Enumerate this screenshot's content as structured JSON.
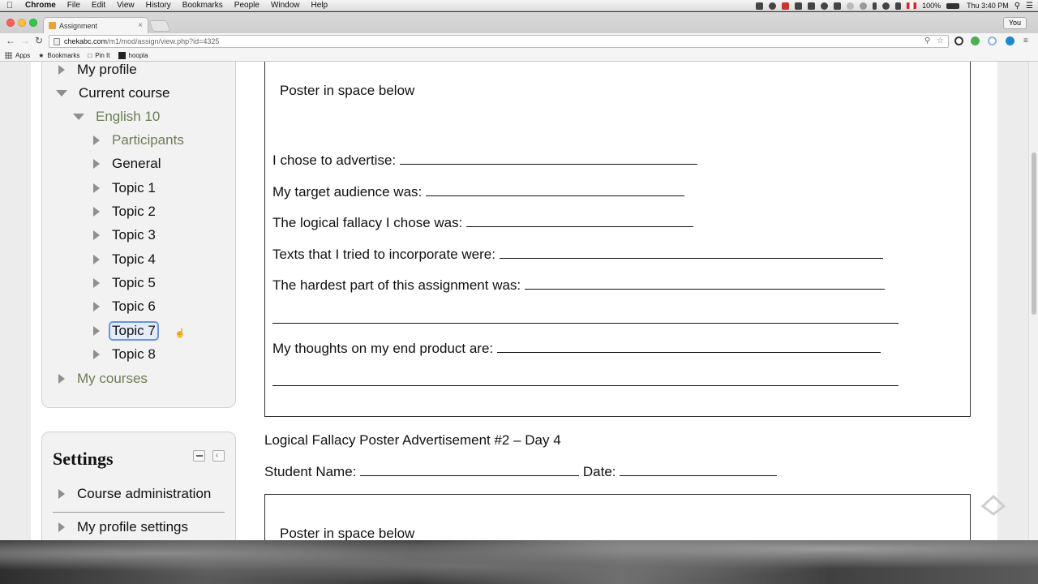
{
  "menubar": {
    "apple": "",
    "items": [
      "Chrome",
      "File",
      "Edit",
      "View",
      "History",
      "Bookmarks",
      "People",
      "Window",
      "Help"
    ],
    "battery": "100%",
    "clock": "Thu 3:40 PM"
  },
  "browser": {
    "tab_title": "Assignment",
    "tab_close": "×",
    "profile": "You",
    "url_host": "chekabc.com",
    "url_path": "/m1/mod/assign/view.php?id=4325",
    "bookmarks": [
      "Apps",
      "Bookmarks",
      "Pin It",
      "hoopla"
    ]
  },
  "navigation": {
    "my_profile": "My profile",
    "current_course": "Current course",
    "course": "English 10",
    "participants": "Participants",
    "general": "General",
    "topics": [
      "Topic 1",
      "Topic 2",
      "Topic 3",
      "Topic 4",
      "Topic 5",
      "Topic 6",
      "Topic 7",
      "Topic 8"
    ],
    "my_courses": "My courses",
    "focused_item": "Topic 7"
  },
  "settings": {
    "title": "Settings",
    "course_admin": "Course administration",
    "profile_settings": "My profile settings"
  },
  "worksheet": {
    "poster_label": "Poster in space below",
    "q_advertise": "I chose to advertise:",
    "q_audience": "My target audience was:",
    "q_fallacy": "The logical fallacy I chose was:",
    "q_texts": "Texts that I tried to incorporate were:",
    "q_hardest": "The hardest part of this assignment was:",
    "q_thoughts": "My thoughts on my end product are:",
    "heading2": "Logical Fallacy Poster Advertisement #2 – Day 4",
    "student_name": "Student Name:",
    "date": "Date:",
    "poster_label2": "Poster in space below"
  }
}
